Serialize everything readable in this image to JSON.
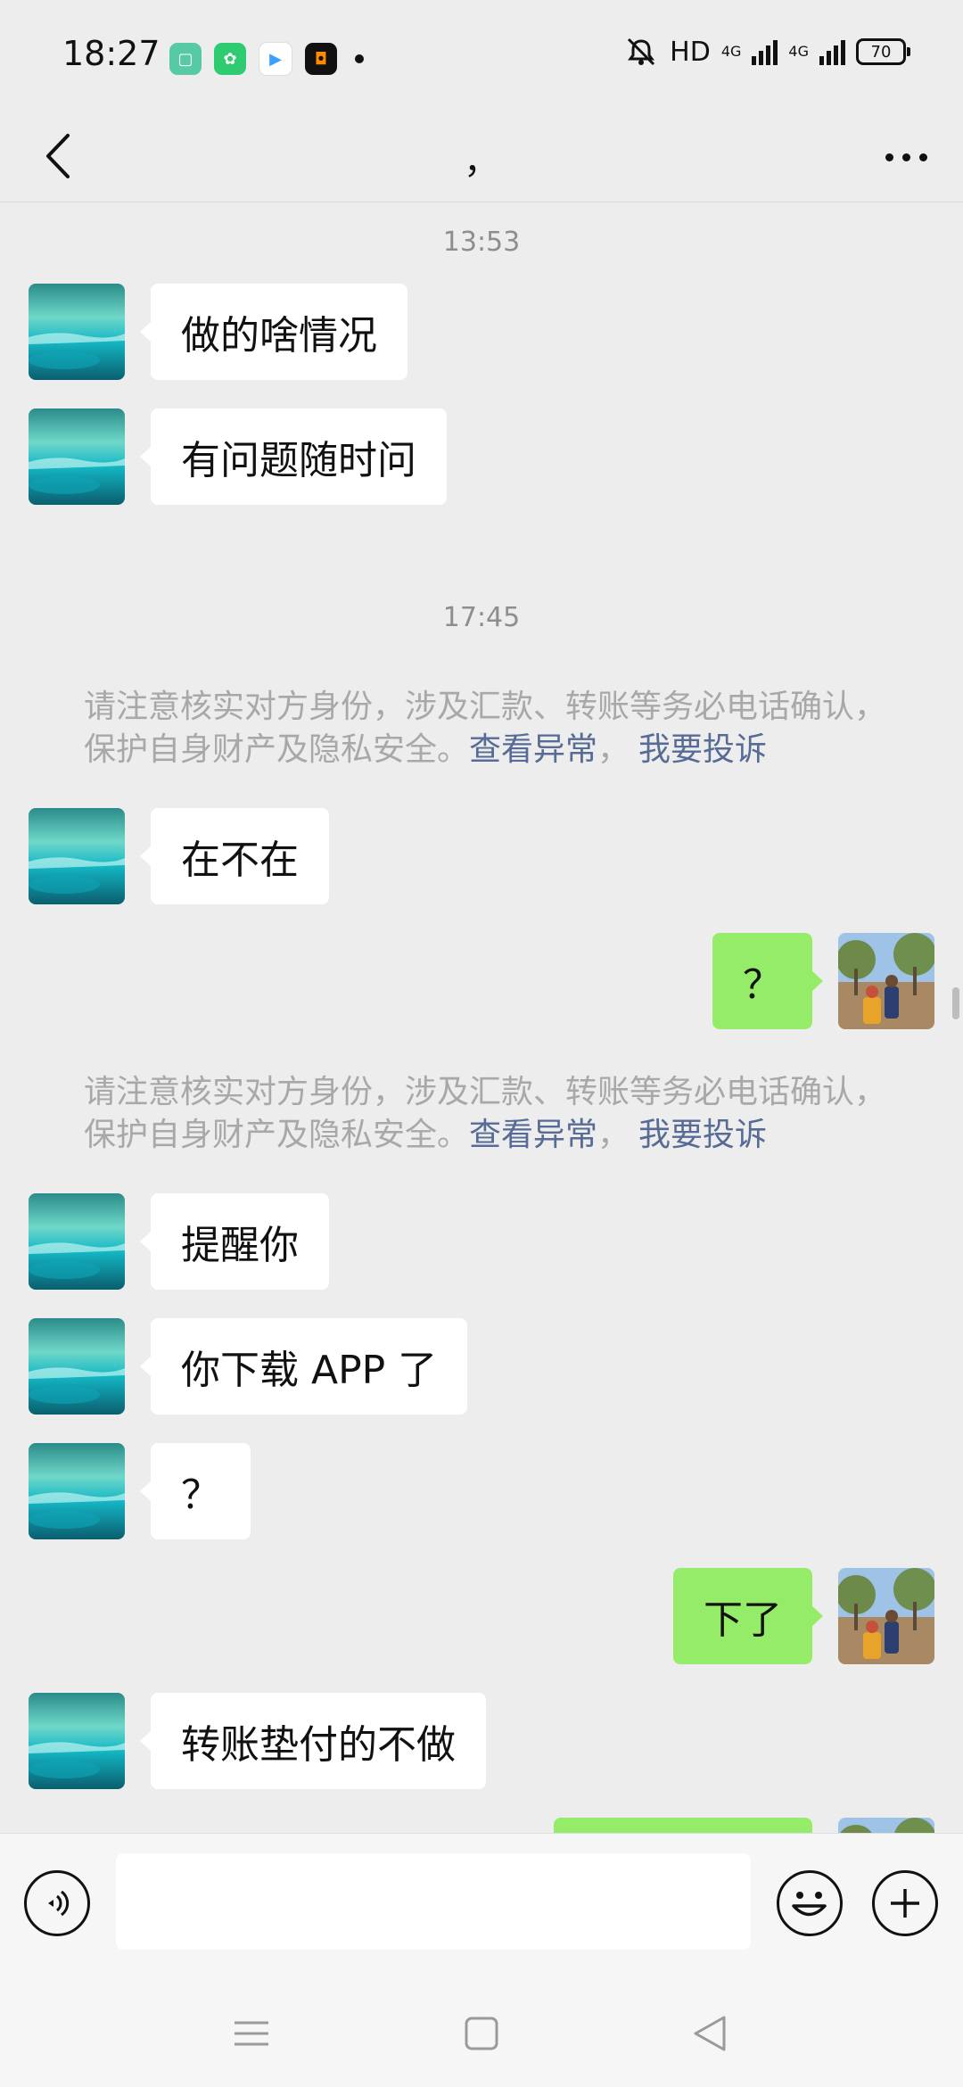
{
  "status_bar": {
    "time": "18:27",
    "network_label": "HD",
    "network_type_1": "4G",
    "network_type_2": "4G",
    "battery": "70",
    "app_icons": [
      "notes-app-icon",
      "wechat-work-icon",
      "video-app-icon",
      "news-app-icon"
    ]
  },
  "nav": {
    "title": "，"
  },
  "chat": {
    "items": [
      {
        "type": "timestamp",
        "text": "13:53"
      },
      {
        "type": "message",
        "side": "in",
        "text": "做的啥情况"
      },
      {
        "type": "message",
        "side": "in",
        "text": "有问题随时问"
      },
      {
        "type": "timestamp",
        "text": "17:45"
      },
      {
        "type": "notice",
        "text": "请注意核实对方身份，涉及汇款、转账等务必电话确认，保护自身财产及隐私安全。",
        "link1": "查看异常",
        "sep": "，",
        "link2": "我要投诉"
      },
      {
        "type": "message",
        "side": "in",
        "text": "在不在"
      },
      {
        "type": "message",
        "side": "out",
        "text": "？"
      },
      {
        "type": "notice",
        "text": "请注意核实对方身份，涉及汇款、转账等务必电话确认，保护自身财产及隐私安全。",
        "link1": "查看异常",
        "sep": "，",
        "link2": "我要投诉"
      },
      {
        "type": "message",
        "side": "in",
        "text": "提醒你"
      },
      {
        "type": "message",
        "side": "in",
        "text": "你下载 APP 了"
      },
      {
        "type": "message",
        "side": "in",
        "text": "？"
      },
      {
        "type": "message",
        "side": "out",
        "text": "下了"
      },
      {
        "type": "message",
        "side": "in",
        "text": "转账垫付的不做"
      },
      {
        "type": "message",
        "side": "out",
        "text": ""
      }
    ]
  },
  "input_bar": {
    "placeholder": "",
    "value": ""
  },
  "colors": {
    "background": "#ededed",
    "bubble_in": "#ffffff",
    "bubble_out": "#95ec69",
    "link": "#576b95",
    "notice_text": "#a8a8a8"
  }
}
